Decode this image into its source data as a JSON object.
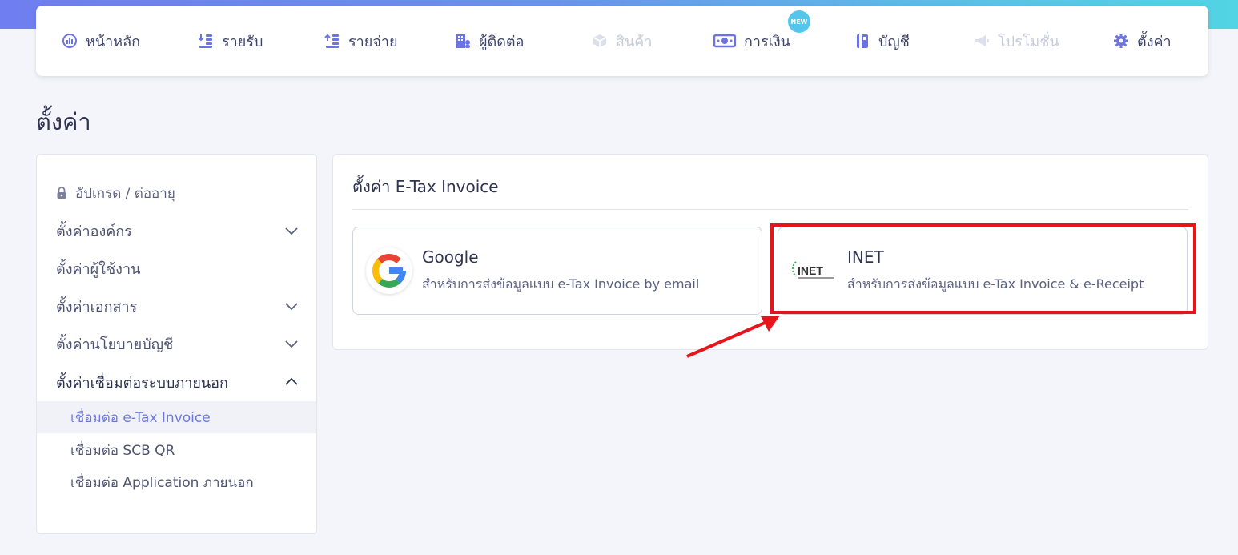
{
  "nav": {
    "items": [
      {
        "label": "หน้าหลัก",
        "icon": "dashboard-icon",
        "disabled": false
      },
      {
        "label": "รายรับ",
        "icon": "income-list-icon",
        "disabled": false
      },
      {
        "label": "รายจ่าย",
        "icon": "expense-list-icon",
        "disabled": false
      },
      {
        "label": "ผู้ติดต่อ",
        "icon": "contacts-building-icon",
        "disabled": false
      },
      {
        "label": "สินค้า",
        "icon": "product-box-icon",
        "disabled": true
      },
      {
        "label": "การเงิน",
        "icon": "money-icon",
        "disabled": false
      },
      {
        "label": "บัญชี",
        "icon": "ledger-book-icon",
        "disabled": false
      },
      {
        "label": "โปรโมชั่น",
        "icon": "megaphone-icon",
        "disabled": true
      },
      {
        "label": "ตั้งค่า",
        "icon": "gear-icon",
        "disabled": false
      }
    ],
    "new_badge": "NEW"
  },
  "page_title": "ตั้งค่า",
  "sidebar": {
    "items": [
      {
        "label": "อัปเกรด / ต่ออายุ",
        "icon": "lock-icon"
      },
      {
        "label": "ตั้งค่าองค์กร",
        "chevron": "down"
      },
      {
        "label": "ตั้งค่าผู้ใช้งาน"
      },
      {
        "label": "ตั้งค่าเอกสาร",
        "chevron": "down"
      },
      {
        "label": "ตั้งค่านโยบายบัญชี",
        "chevron": "down"
      },
      {
        "label": "ตั้งค่าเชื่อมต่อระบบภายนอก",
        "chevron": "up"
      }
    ],
    "sub_items": [
      {
        "label": "เชื่อมต่อ e-Tax Invoice",
        "active": true
      },
      {
        "label": "เชื่อมต่อ SCB QR",
        "active": false
      },
      {
        "label": "เชื่อมต่อ Application ภายนอก",
        "active": false
      }
    ]
  },
  "content": {
    "title": "ตั้งค่า E-Tax Invoice",
    "providers": [
      {
        "name": "Google",
        "desc": "สำหรับการส่งข้อมูลแบบ e-Tax Invoice by email",
        "logo": "google-logo"
      },
      {
        "name": "INET",
        "desc": "สำหรับการส่งข้อมูลแบบ e-Tax Invoice & e-Receipt",
        "logo": "inet-logo",
        "logo_text": "INET"
      }
    ]
  },
  "colors": {
    "accent": "#6d79e3",
    "highlight": "#e8141b",
    "gradient_start": "#6f7ef0",
    "gradient_end": "#52d4e4"
  }
}
